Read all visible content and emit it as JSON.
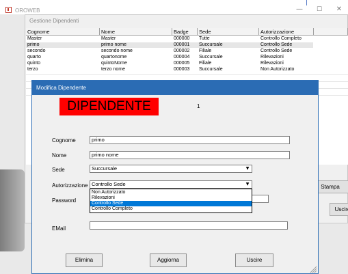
{
  "app": {
    "title": "OROWEB",
    "minimize": "—",
    "maximize": "☐",
    "close": "✕"
  },
  "list_window": {
    "title": "Gestione Dipendenti",
    "columns": [
      "Cognome",
      "Nome",
      "Badge",
      "Sede",
      "Autorizzazione"
    ],
    "rows": [
      [
        "Master",
        "Master",
        "000000",
        "Tutte",
        "Controllo Completo"
      ],
      [
        "primo",
        "primo nome",
        "000001",
        "Succursale",
        "Controllo Sede"
      ],
      [
        "secondo",
        "secondo nome",
        "000002",
        "Filiale",
        "Controllo Sede"
      ],
      [
        "quarto",
        "quartonome",
        "000004",
        "Succursale",
        "Rilevazioni"
      ],
      [
        "quinto",
        "quintoNome",
        "000005",
        "Filiale",
        "Rilevazioni"
      ],
      [
        "terzo",
        "terzo nome",
        "000003",
        "Succursale",
        "Non Autorizzato"
      ]
    ],
    "stampa_label": "Stampa",
    "uscire_label": "Uscire"
  },
  "dialog": {
    "title": "Modifica Dipendente",
    "banner": "DIPENDENTE",
    "record_number": "1",
    "labels": {
      "cognome": "Cognome",
      "nome": "Nome",
      "sede": "Sede",
      "autorizzazione": "Autorizzazione",
      "password": "Password",
      "email": "EMail"
    },
    "values": {
      "cognome": "primo",
      "nome": "primo nome",
      "sede": "Succursale",
      "autorizzazione": "Controllo Sede",
      "password": "",
      "email": ""
    },
    "autorizzazione_options": [
      "Non Autorizzato",
      "Rilevazioni",
      "Controllo Sede",
      "Controllo Completo"
    ],
    "buttons": {
      "elimina": "Elimina",
      "aggiorna": "Aggiorna",
      "uscire": "Uscire"
    },
    "dropdown_arrow": "▼"
  },
  "colors": {
    "dialog_title": "#2b6cb4",
    "banner": "#ff0000",
    "highlight": "#0078d7"
  }
}
